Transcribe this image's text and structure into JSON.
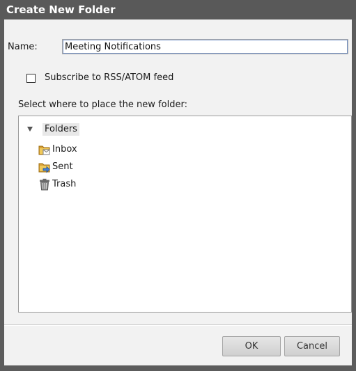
{
  "dialog": {
    "title": "Create New Folder"
  },
  "name_field": {
    "label": "Name:",
    "value": "Meeting Notifications"
  },
  "rss": {
    "label": "Subscribe to RSS/ATOM feed",
    "checked": false
  },
  "location": {
    "label": "Select where to place the new folder:"
  },
  "tree": {
    "root": {
      "label": "Folders",
      "expanded": true,
      "icon": "triangle-down-icon"
    },
    "items": [
      {
        "label": "Inbox",
        "icon": "inbox-folder-icon"
      },
      {
        "label": "Sent",
        "icon": "sent-folder-icon"
      },
      {
        "label": "Trash",
        "icon": "trash-icon"
      }
    ]
  },
  "buttons": {
    "ok": "OK",
    "cancel": "Cancel"
  },
  "colors": {
    "titlebar": "#595959",
    "body": "#f2f2f2",
    "folder": "#e3b23c"
  }
}
